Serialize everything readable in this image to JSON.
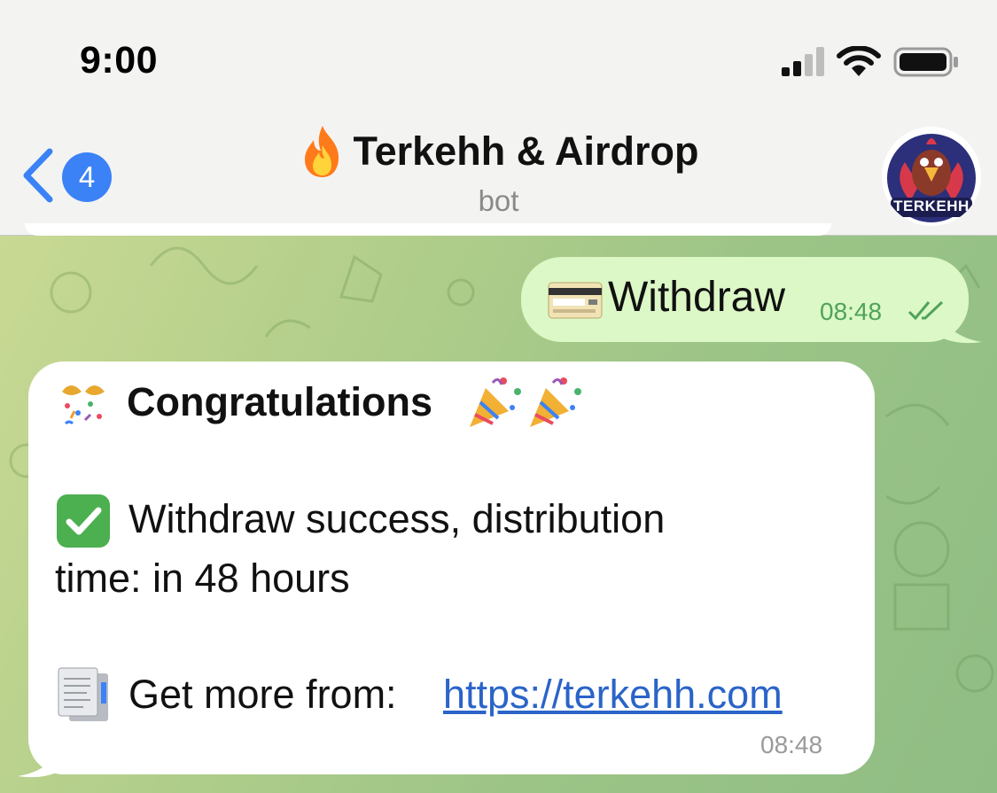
{
  "status_bar": {
    "time": "9:00"
  },
  "header": {
    "back_count": "4",
    "title": "Terkehh & Airdrop",
    "subtitle": "bot",
    "avatar_text": "TERKEHH"
  },
  "messages": {
    "outgoing": {
      "text": "Withdraw",
      "time": "08:48"
    },
    "incoming": {
      "heading": "Congratulations",
      "line_1": "Withdraw success, distribution",
      "line_2": "time: in 48 hours",
      "line_3": "Get more from: ",
      "link": "https://terkehh.com",
      "time": "08:48"
    }
  },
  "colors": {
    "accent": "#3b82f6",
    "outgoing_bubble": "#dcf8c6",
    "incoming_bubble": "#ffffff",
    "link": "#2a64c8",
    "chat_background": "#a9c98e"
  },
  "icons": {
    "signal": "signal-icon",
    "wifi": "wifi-icon",
    "battery": "battery-icon",
    "back": "chevron-left-icon",
    "fire": "fire-icon",
    "card": "credit-card-icon",
    "read": "double-check-icon",
    "gift": "wrapped-gift-icon",
    "party": "party-popper-icon",
    "check": "check-mark-button-icon",
    "document": "document-icon"
  }
}
